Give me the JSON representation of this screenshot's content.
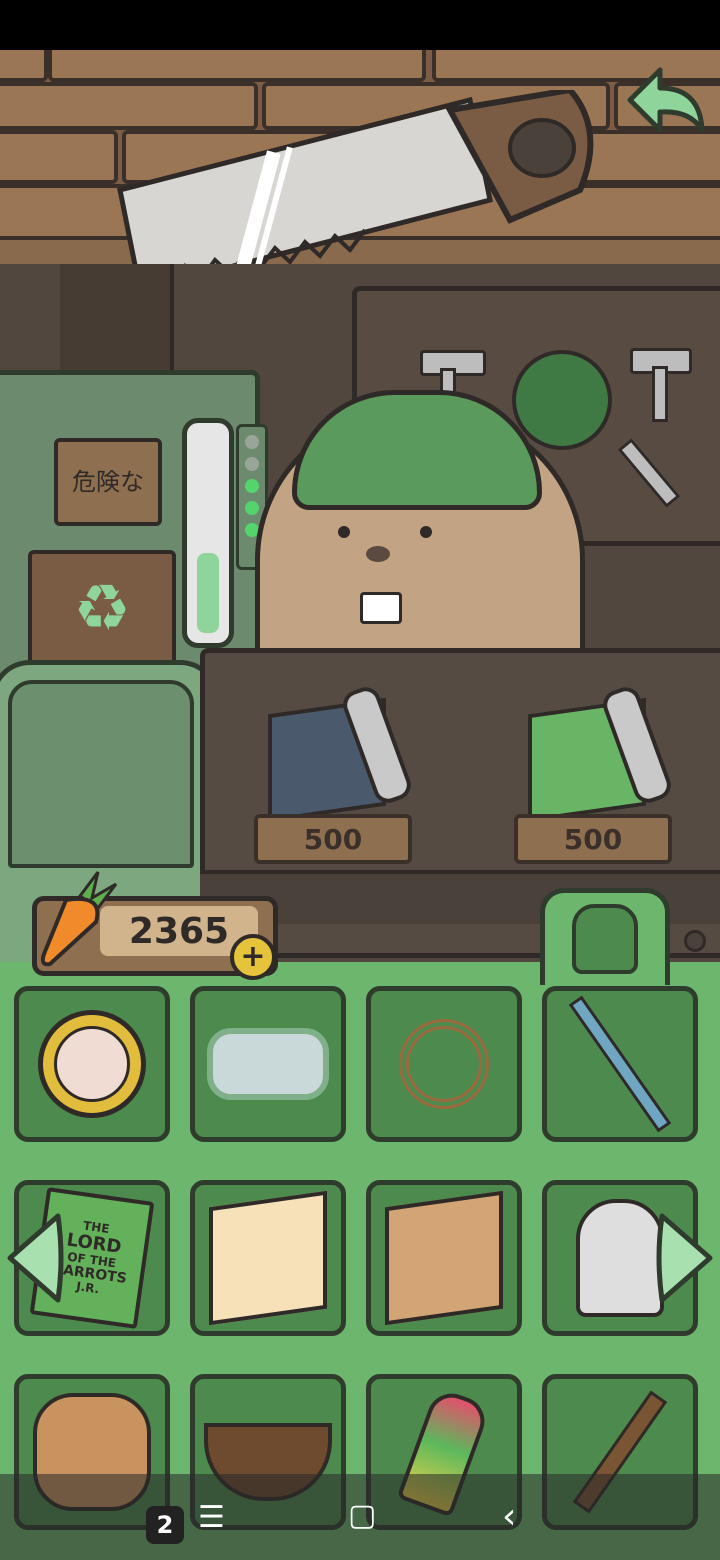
{
  "currency": {
    "amount": "2365",
    "icon": "carrot-icon",
    "add_icon": "plus-icon"
  },
  "shop": {
    "items": [
      {
        "name": "dark-map",
        "price": "500"
      },
      {
        "name": "green-map",
        "price": "500"
      }
    ]
  },
  "signs": {
    "danger_sign": "危険な"
  },
  "inventory": {
    "tab_icon": "backpack-icon",
    "slots": [
      {
        "name": "compass-icon"
      },
      {
        "name": "diving-mask-icon"
      },
      {
        "name": "rope-icon"
      },
      {
        "name": "trekking-pole-icon"
      },
      {
        "name": "book-icon",
        "title_line1": "THE",
        "title_line2": "LORD",
        "title_line3": "OF THE",
        "title_line4": "CARROTS",
        "author": "J.R."
      },
      {
        "name": "carrot-map-icon"
      },
      {
        "name": "brown-map-icon"
      },
      {
        "name": "bug-net-icon"
      },
      {
        "name": "gingerbread-bunnies-icon"
      },
      {
        "name": "rice-bowl-icon"
      },
      {
        "name": "popsicle-icon"
      },
      {
        "name": "pickaxe-icon"
      }
    ]
  },
  "nav": {
    "badge": "2",
    "menu_glyph": "☰",
    "home_glyph": "▢",
    "back_glyph": "‹"
  },
  "colors": {
    "panel_green": "#6cb76d",
    "slot_green": "#4c8a4e",
    "wall_brown": "#9b7654"
  }
}
